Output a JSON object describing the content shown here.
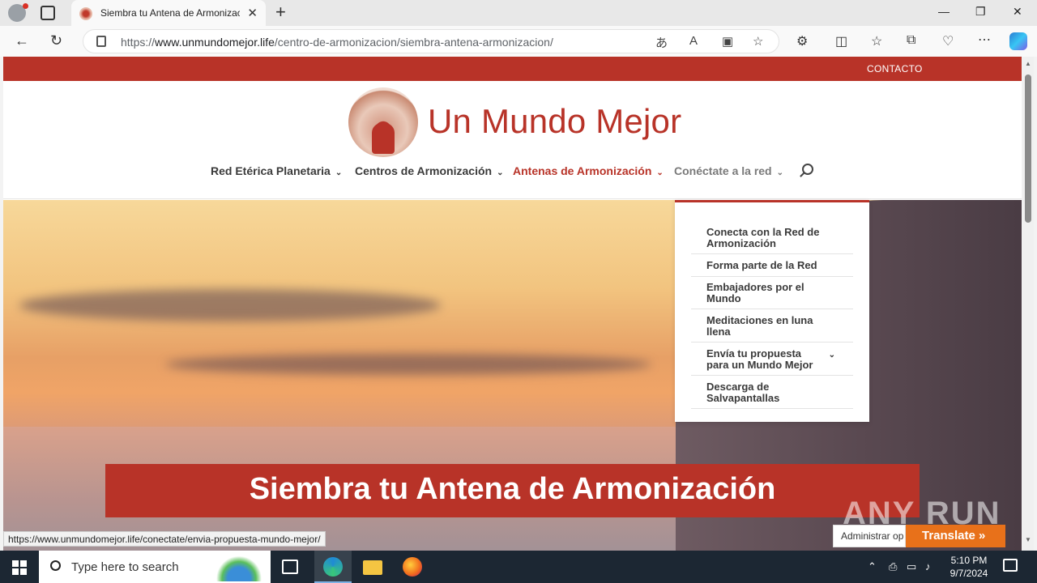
{
  "browser": {
    "tab_title": "Siembra tu Antena de Armonizac",
    "url_prefix": "https://",
    "url_domain": "www.unmundomejor.life",
    "url_path": "/centro-de-armonizacion/siembra-antena-armonizacion/",
    "window_controls": {
      "minimize": "—",
      "restore": "❐",
      "close": "✕"
    }
  },
  "site": {
    "topbar_link": "CONTACTO",
    "logo_text": "Un Mundo Mejor",
    "menu": [
      {
        "label": "Red Etérica Planetaria"
      },
      {
        "label": "Centros de Armonización"
      },
      {
        "label": "Antenas de Armonización"
      },
      {
        "label": "Conéctate a la red"
      }
    ],
    "dropdown": [
      {
        "line1": "Conecta con la Red de",
        "line2": "Armonización"
      },
      {
        "line1": "Forma parte de la Red",
        "line2": ""
      },
      {
        "line1": "Embajadores por el",
        "line2": "Mundo"
      },
      {
        "line1": "Meditaciones en luna",
        "line2": "llena"
      },
      {
        "line1": "Envía tu propuesta",
        "line2": "para un Mundo Mejor"
      },
      {
        "line1": "Descarga de",
        "line2": "Salvapantallas"
      }
    ],
    "hero_title": "Siembra tu Antena de Armonización"
  },
  "status_url": "https://www.unmundomejor.life/conectate/envia-propuesta-mundo-mejor/",
  "widgets": {
    "admin_label": "Administrar op",
    "translate_label": "Translate »",
    "watermark": "ANY RUN"
  },
  "taskbar": {
    "search_placeholder": "Type here to search",
    "time": "5:10 PM",
    "date": "9/7/2024"
  }
}
